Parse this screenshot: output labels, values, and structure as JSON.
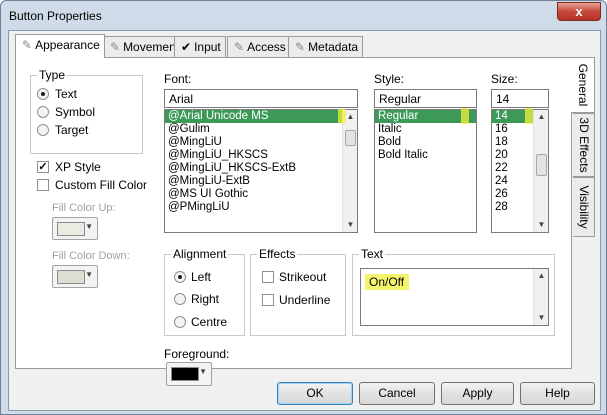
{
  "window": {
    "title": "Button Properties",
    "close_glyph": "x"
  },
  "tabs": [
    {
      "label": "Appearance",
      "icon": "pencil-icon"
    },
    {
      "label": "Movement",
      "icon": "pencil-icon"
    },
    {
      "label": "Input",
      "icon": "check-icon"
    },
    {
      "label": "Access",
      "icon": "pencil-icon"
    },
    {
      "label": "Metadata",
      "icon": "pencil-icon"
    }
  ],
  "side_tabs": [
    "General",
    "3D Effects",
    "Visibility"
  ],
  "type_group": {
    "title": "Type",
    "options": [
      "Text",
      "Symbol",
      "Target"
    ],
    "selected": "Text"
  },
  "xp_style": {
    "label": "XP Style",
    "checked": true
  },
  "custom_fill": {
    "label": "Custom Fill Color",
    "checked": false
  },
  "fill_up": {
    "label": "Fill Color Up:",
    "color": "#ebebe3"
  },
  "fill_down": {
    "label": "Fill Color Down:",
    "color": "#ddddd2"
  },
  "font": {
    "label": "Font:",
    "value": "Arial",
    "items": [
      "@Arial Unicode MS",
      "@Gulim",
      "@MingLiU",
      "@MingLiU_HKSCS",
      "@MingLiU_HKSCS-ExtB",
      "@MingLiU-ExtB",
      "@MS UI Gothic",
      "@PMingLiU"
    ],
    "selected": "@Arial Unicode MS"
  },
  "style": {
    "label": "Style:",
    "value": "Regular",
    "items": [
      "Regular",
      "Italic",
      "Bold",
      "Bold Italic"
    ],
    "selected": "Regular"
  },
  "size": {
    "label": "Size:",
    "value": "14",
    "items": [
      "14",
      "16",
      "18",
      "20",
      "22",
      "24",
      "26",
      "28"
    ],
    "selected": "14"
  },
  "alignment": {
    "title": "Alignment",
    "options": [
      "Left",
      "Right",
      "Centre"
    ],
    "selected": "Left"
  },
  "effects": {
    "title": "Effects",
    "strikeout": "Strikeout",
    "underline": "Underline"
  },
  "text_group": {
    "title": "Text",
    "value": "On/Off"
  },
  "foreground": {
    "label": "Foreground:",
    "color": "#000000"
  },
  "buttons": {
    "ok": "OK",
    "cancel": "Cancel",
    "apply": "Apply",
    "help": "Help"
  },
  "colors": {
    "selection": "#3c9957",
    "highlight": "#f1f23c"
  }
}
